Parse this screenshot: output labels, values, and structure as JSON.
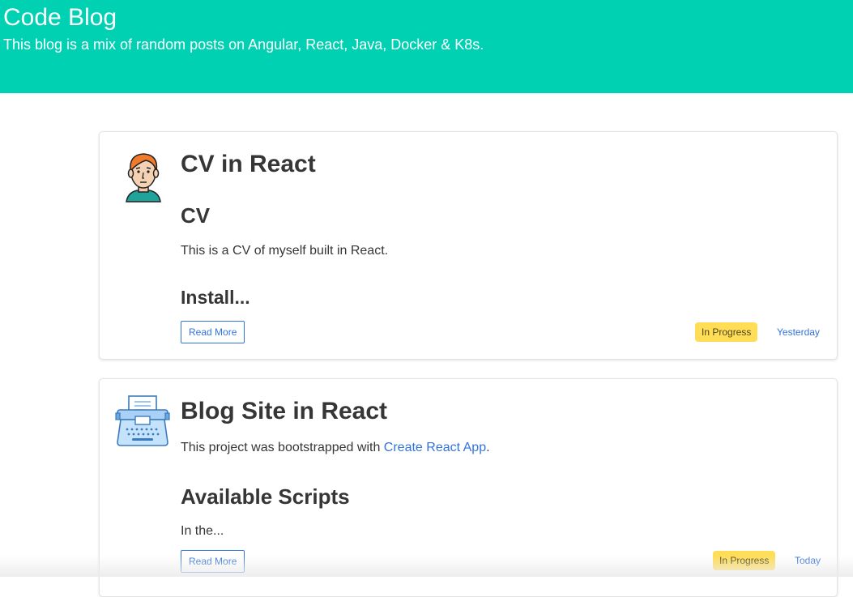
{
  "header": {
    "title": "Code Blog",
    "subtitle": "This blog is a mix of random posts on Angular, React, Java, Docker & K8s."
  },
  "posts": [
    {
      "title": "CV in React",
      "heading": "CV",
      "paragraph": "This is a CV of myself built in React.",
      "subheading": "Install...",
      "read_more": "Read More",
      "status": "In Progress",
      "date": "Yesterday",
      "icon": "person-avatar-icon"
    },
    {
      "title": "Blog Site in React",
      "paragraph_prefix": "This project was bootstrapped with ",
      "link_text": "Create React App",
      "paragraph_suffix": ".",
      "heading": "Available Scripts",
      "paragraph2": "In the...",
      "read_more": "Read More",
      "status": "In Progress",
      "date": "Today",
      "icon": "typewriter-icon"
    }
  ],
  "colors": {
    "hero": "#00d1b2",
    "link": "#3273dc",
    "tag": "#ffdd57",
    "text": "#363636"
  }
}
